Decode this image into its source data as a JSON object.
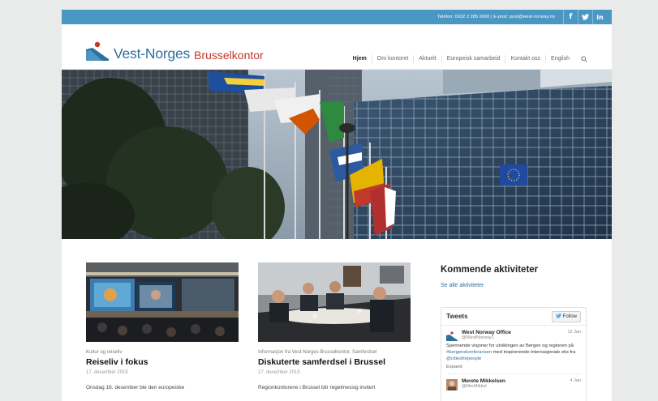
{
  "topbar": {
    "contact": "Telefon: 0032 2 285 0000 | E-post: post@west-norway.no",
    "social": [
      {
        "icon": "facebook-icon",
        "glyph": "f"
      },
      {
        "icon": "twitter-icon",
        "glyph": "t"
      },
      {
        "icon": "linkedin-icon",
        "glyph": "in"
      }
    ]
  },
  "header": {
    "logo_name": "Vest-Norges",
    "logo_office": "Brusselkontor",
    "logo_colors": {
      "blue": "#2e6f9c",
      "red": "#c0392b"
    },
    "nav": [
      "Hjem",
      "Om kontoret",
      "Aktuelt",
      "Europeisk samarbeid",
      "Kontakt oss",
      "English"
    ],
    "nav_active": "Hjem"
  },
  "articles": [
    {
      "category": "Kultur og reiseliv",
      "title": "Reiseliv i fokus",
      "date": "17. desember 2015",
      "excerpt": "Onsdag 16. desember ble den europeiske"
    },
    {
      "category": "Informasjon fra Vest-Norges Brusselkontor, Samferdsel",
      "title": "Diskuterte samferdsel i Brussel",
      "date": "17. desember 2015",
      "excerpt": "Regionkontorene i Brussel blir regelmessig invitert"
    }
  ],
  "sidebar": {
    "heading": "Kommende aktiviteter",
    "see_all": "Se alle aktiviteter"
  },
  "tweets": {
    "label": "Tweets",
    "follow": "Follow",
    "items": [
      {
        "name": "West Norway Office",
        "handle": "@WestNorway1",
        "time": "12 Jan",
        "text_before": "Spennende visjoner for utviklingen av Bergen og regionen på ",
        "hashtag": "#bergenskonferansen",
        "text_middle": " med inspirerende internasjonale eks fra ",
        "mention": "@citiesforpeople",
        "expand": "Expand"
      },
      {
        "name": "Merete Mikkelsen",
        "handle": "@MerMikkel",
        "time": "4 Jan"
      }
    ]
  },
  "colors": {
    "accent": "#4a97c4",
    "link": "#2e6f9c"
  }
}
